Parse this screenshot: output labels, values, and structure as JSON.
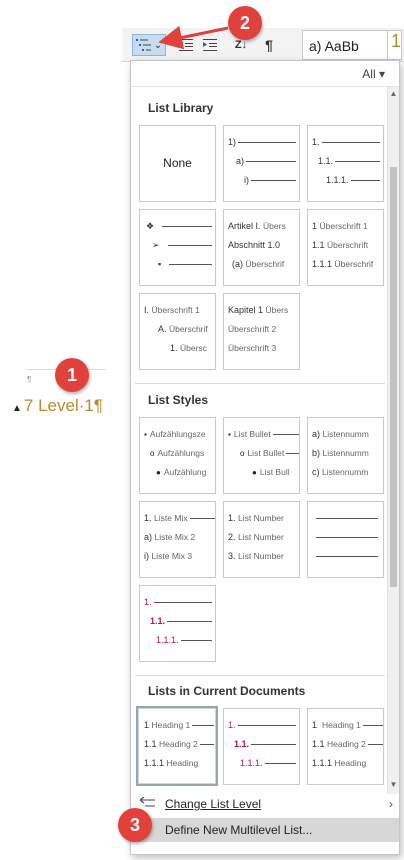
{
  "ribbon": {
    "gallery_sample": "a)  AaBb",
    "gallery_heading": "1",
    "sort_icon": "sort-az-icon",
    "pilcrow": "¶",
    "caret": "⌄"
  },
  "document": {
    "para_mark": "¶",
    "heading_marker": "▲",
    "heading_text": "7 Level·1¶"
  },
  "panel": {
    "filter_label": "All ▾",
    "sections": {
      "library": "List Library",
      "styles": "List Styles",
      "current": "Lists in Current Documents"
    },
    "library": {
      "none_label": "None",
      "t2": [
        "1)",
        "a)",
        "i)"
      ],
      "t3": [
        "1.",
        "1.1.",
        "1.1.1."
      ],
      "t4": [
        "❖",
        "➢",
        "▪"
      ],
      "t5": [
        {
          "n": "Artikel I.",
          "g": "Übers"
        },
        {
          "n": "Abschnitt 1.0",
          "g": ""
        },
        {
          "n": "(a)",
          "g": "Überschrif"
        }
      ],
      "t6": [
        {
          "n": "1",
          "g": "Überschrift 1"
        },
        {
          "n": "1.1",
          "g": "Überschrift"
        },
        {
          "n": "1.1.1",
          "g": "Überschrif"
        }
      ],
      "t7": [
        {
          "n": "I.",
          "g": "Überschrift 1"
        },
        {
          "n": "A.",
          "g": "Überschrif"
        },
        {
          "n": "1.",
          "g": "Übersc"
        }
      ],
      "t8": [
        {
          "n": "Kapitel 1",
          "g": "Übers"
        },
        {
          "n": "",
          "g": "Überschrift 2"
        },
        {
          "n": "",
          "g": "Überschrift 3"
        }
      ]
    },
    "styles": {
      "s1": [
        {
          "b": "▪",
          "g": "Aufzählungsze"
        },
        {
          "b": "o",
          "g": "Aufzählungs"
        },
        {
          "b": "●",
          "g": "Aufzählung"
        }
      ],
      "s2": [
        {
          "b": "▪",
          "g": "List Bullet"
        },
        {
          "b": "o",
          "g": "List Bullet"
        },
        {
          "b": "●",
          "g": "List Bull"
        }
      ],
      "s3": [
        {
          "n": "a)",
          "g": "Listennumm"
        },
        {
          "n": "b)",
          "g": "Listennumm"
        },
        {
          "n": "c)",
          "g": "Listennumm"
        }
      ],
      "s4": [
        {
          "n": "1.",
          "g": "Liste Mix"
        },
        {
          "n": "a)",
          "g": "Liste Mix 2"
        },
        {
          "n": "i)",
          "g": "Liste Mix 3"
        }
      ],
      "s5": [
        {
          "n": "1.",
          "g": "List Number"
        },
        {
          "n": "2.",
          "g": "List Number"
        },
        {
          "n": "3.",
          "g": "List Number"
        }
      ],
      "s7": [
        "1.",
        "1.1.",
        "1.1.1."
      ]
    },
    "current": {
      "c1": [
        {
          "n": "1",
          "g": "Heading 1"
        },
        {
          "n": "1.1",
          "g": "Heading 2"
        },
        {
          "n": "1.1.1",
          "g": "Heading"
        }
      ],
      "c2": [
        "1.",
        "1.1.",
        "1.1.1."
      ],
      "c3": [
        {
          "n": "1",
          "g": "Heading 1"
        },
        {
          "n": "1.1",
          "g": "Heading 2"
        },
        {
          "n": "1.1.1",
          "g": "Heading"
        }
      ]
    },
    "commands": {
      "change_level": "Change List Level",
      "define_new": "Define New Multilevel List..."
    }
  },
  "callouts": [
    "1",
    "2",
    "3"
  ],
  "colors": {
    "callout": "#e1413a",
    "heading_gold": "#b58a2a",
    "list_red": "#c0143c",
    "hover_gray": "#d7d7d7"
  }
}
